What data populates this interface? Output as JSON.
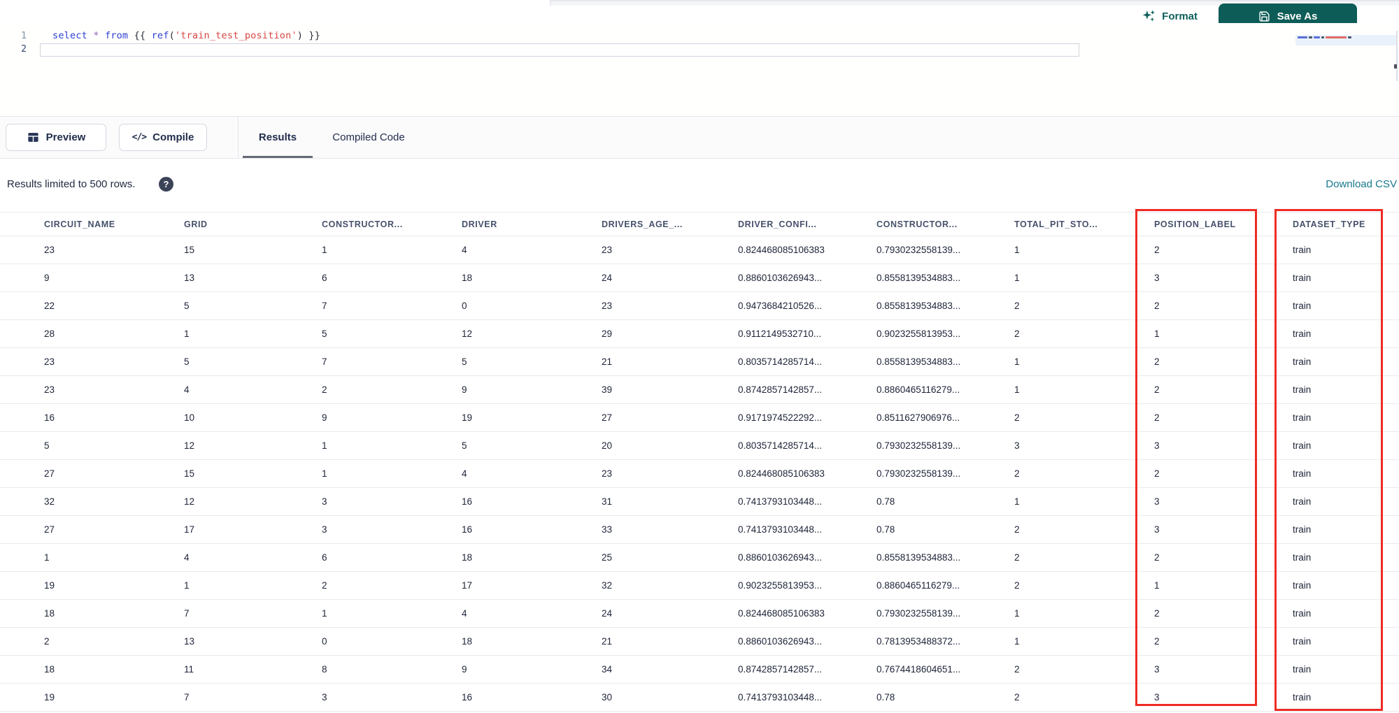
{
  "topbar": {
    "format_label": "Format",
    "save_as_label": "Save As"
  },
  "editor": {
    "lines": [
      {
        "number": "1",
        "tokens": [
          {
            "text": "select",
            "type": "keyword"
          },
          {
            "text": " ",
            "type": "plain"
          },
          {
            "text": "*",
            "type": "operator"
          },
          {
            "text": " ",
            "type": "plain"
          },
          {
            "text": "from",
            "type": "keyword"
          },
          {
            "text": " {{ ",
            "type": "plain"
          },
          {
            "text": "ref",
            "type": "keyword"
          },
          {
            "text": "(",
            "type": "plain"
          },
          {
            "text": "'train_test_position'",
            "type": "string"
          },
          {
            "text": ") }}",
            "type": "plain"
          }
        ]
      },
      {
        "number": "2",
        "tokens": []
      }
    ]
  },
  "toolbar": {
    "preview_label": "Preview",
    "compile_label": "Compile",
    "compile_icon_glyph": "</>",
    "tabs": [
      {
        "label": "Results",
        "active": true
      },
      {
        "label": "Compiled Code",
        "active": false
      }
    ]
  },
  "results_bar": {
    "limit_text": "Results limited to 500 rows.",
    "help_glyph": "?",
    "download_label": "Download CSV"
  },
  "table": {
    "columns": [
      "CIRCUIT_NAME",
      "GRID",
      "CONSTRUCTOR...",
      "DRIVER",
      "DRIVERS_AGE_...",
      "DRIVER_CONFI...",
      "CONSTRUCTOR...",
      "TOTAL_PIT_STO...",
      "POSITION_LABEL",
      "DATASET_TYPE"
    ],
    "highlighted_columns": [
      "POSITION_LABEL",
      "DATASET_TYPE"
    ],
    "highlight_color": "#ee2c24",
    "rows": [
      [
        "23",
        "15",
        "1",
        "4",
        "23",
        "0.824468085106383",
        "0.7930232558139...",
        "1",
        "2",
        "train"
      ],
      [
        "9",
        "13",
        "6",
        "18",
        "24",
        "0.8860103626943...",
        "0.8558139534883...",
        "1",
        "3",
        "train"
      ],
      [
        "22",
        "5",
        "7",
        "0",
        "23",
        "0.9473684210526...",
        "0.8558139534883...",
        "2",
        "2",
        "train"
      ],
      [
        "28",
        "1",
        "5",
        "12",
        "29",
        "0.9112149532710...",
        "0.9023255813953...",
        "2",
        "1",
        "train"
      ],
      [
        "23",
        "5",
        "7",
        "5",
        "21",
        "0.8035714285714...",
        "0.8558139534883...",
        "1",
        "2",
        "train"
      ],
      [
        "23",
        "4",
        "2",
        "9",
        "39",
        "0.8742857142857...",
        "0.8860465116279...",
        "1",
        "2",
        "train"
      ],
      [
        "16",
        "10",
        "9",
        "19",
        "27",
        "0.9171974522292...",
        "0.8511627906976...",
        "2",
        "2",
        "train"
      ],
      [
        "5",
        "12",
        "1",
        "5",
        "20",
        "0.8035714285714...",
        "0.7930232558139...",
        "3",
        "3",
        "train"
      ],
      [
        "27",
        "15",
        "1",
        "4",
        "23",
        "0.824468085106383",
        "0.7930232558139...",
        "2",
        "2",
        "train"
      ],
      [
        "32",
        "12",
        "3",
        "16",
        "31",
        "0.7413793103448...",
        "0.78",
        "1",
        "3",
        "train"
      ],
      [
        "27",
        "17",
        "3",
        "16",
        "33",
        "0.7413793103448...",
        "0.78",
        "2",
        "3",
        "train"
      ],
      [
        "1",
        "4",
        "6",
        "18",
        "25",
        "0.8860103626943...",
        "0.8558139534883...",
        "2",
        "2",
        "train"
      ],
      [
        "19",
        "1",
        "2",
        "17",
        "32",
        "0.9023255813953...",
        "0.8860465116279...",
        "2",
        "1",
        "train"
      ],
      [
        "18",
        "7",
        "1",
        "4",
        "24",
        "0.824468085106383",
        "0.7930232558139...",
        "1",
        "2",
        "train"
      ],
      [
        "2",
        "13",
        "0",
        "18",
        "21",
        "0.8860103626943...",
        "0.7813953488372...",
        "1",
        "2",
        "train"
      ],
      [
        "18",
        "11",
        "8",
        "9",
        "34",
        "0.8742857142857...",
        "0.7674418604651...",
        "2",
        "3",
        "train"
      ],
      [
        "19",
        "7",
        "3",
        "16",
        "30",
        "0.7413793103448...",
        "0.78",
        "2",
        "3",
        "train"
      ]
    ]
  },
  "colors": {
    "accent_teal": "#0d5c57",
    "link_teal": "#17798e",
    "highlight_red": "#ee2c24"
  }
}
